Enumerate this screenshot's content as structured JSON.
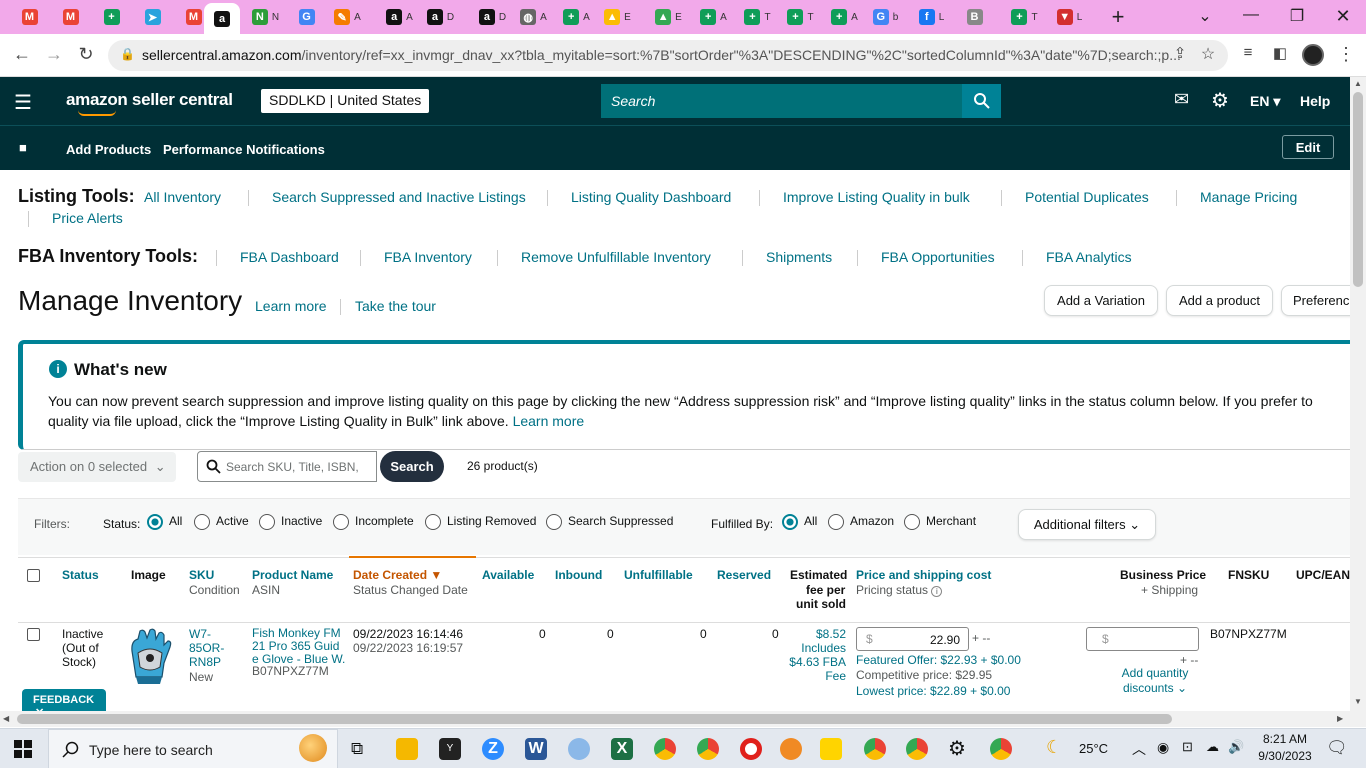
{
  "browser": {
    "tabs": [
      {
        "name": "gmail-icon",
        "color": "#ea4335",
        "glyph": "M"
      },
      {
        "name": "gmail-icon",
        "color": "#ea4335",
        "glyph": "M"
      },
      {
        "name": "sheets-icon",
        "color": "#0f9d58",
        "glyph": "+"
      },
      {
        "name": "telegram-icon",
        "color": "#2aa3dd",
        "glyph": "➤"
      },
      {
        "name": "gmail-icon",
        "color": "#ea4335",
        "glyph": "M"
      },
      {
        "name": "amazon-icon",
        "color": "#111",
        "glyph": "a"
      },
      {
        "name": "wolf-icon",
        "color": "#2e9d3a",
        "glyph": "N"
      },
      {
        "name": "google-icon",
        "color": "#4285f4",
        "glyph": "G"
      },
      {
        "name": "pencil-icon",
        "color": "#f57c00",
        "glyph": "✎"
      },
      {
        "name": "amazon-icon",
        "color": "#111",
        "glyph": "a"
      },
      {
        "name": "amazon-icon",
        "color": "#111",
        "glyph": "a"
      },
      {
        "name": "amazon-icon",
        "color": "#111",
        "glyph": "a"
      },
      {
        "name": "globe-icon",
        "color": "#666",
        "glyph": "◍"
      },
      {
        "name": "sheets-icon",
        "color": "#0f9d58",
        "glyph": "+"
      },
      {
        "name": "drive-icon",
        "color": "#fbbc04",
        "glyph": "▲"
      },
      {
        "name": "drive-icon",
        "color": "#34a853",
        "glyph": "▲"
      },
      {
        "name": "sheets-icon",
        "color": "#0f9d58",
        "glyph": "+"
      },
      {
        "name": "sheets-icon",
        "color": "#0f9d58",
        "glyph": "+"
      },
      {
        "name": "sheets-icon",
        "color": "#0f9d58",
        "glyph": "+"
      },
      {
        "name": "sheets-icon",
        "color": "#0f9d58",
        "glyph": "+"
      },
      {
        "name": "google-icon",
        "color": "#4285f4",
        "glyph": "G"
      },
      {
        "name": "facebook-icon",
        "color": "#1877f2",
        "glyph": "f"
      },
      {
        "name": "audio-tab-icon",
        "color": "#888",
        "glyph": "B"
      },
      {
        "name": "sheets-icon",
        "color": "#0f9d58",
        "glyph": "+"
      },
      {
        "name": "vpn-icon",
        "color": "#d32f2f",
        "glyph": "▼"
      }
    ],
    "tab_letters": [
      "",
      "",
      "",
      "",
      "",
      "",
      "N",
      "",
      "A",
      "A",
      "D",
      "D",
      "A",
      "A",
      "E",
      "E",
      "A",
      "T",
      "T",
      "A",
      "b",
      "L",
      "",
      "T",
      "L"
    ],
    "url_domain": "sellercentral.amazon.com",
    "url_path": "/inventory/ref=xx_invmgr_dnav_xx?tbla_myitable=sort:%7B\"sortOrder\"%3A\"DESCENDING\"%2C\"sortedColumnId\"%3A\"date\"%7D;search:;p..."
  },
  "header": {
    "logo": "amazon seller central",
    "store": "SDDLKD | United States",
    "search_placeholder": "Search",
    "language": "EN",
    "help": "Help"
  },
  "navbar": {
    "items": [
      "Add Products",
      "Performance Notifications"
    ],
    "edit": "Edit"
  },
  "listing_tools": {
    "label": "Listing Tools:",
    "links": [
      "All Inventory",
      "Search Suppressed and Inactive Listings",
      "Listing Quality Dashboard",
      "Improve Listing Quality in bulk",
      "Potential Duplicates",
      "Manage Pricing",
      "Price Alerts"
    ]
  },
  "fba_tools": {
    "label": "FBA Inventory Tools:",
    "links": [
      "FBA Dashboard",
      "FBA Inventory",
      "Remove Unfulfillable Inventory",
      "Shipments",
      "FBA Opportunities",
      "FBA Analytics"
    ]
  },
  "page": {
    "title": "Manage Inventory",
    "learn_more": "Learn more",
    "take_tour": "Take the tour",
    "buttons": [
      "Add a Variation",
      "Add a product",
      "Preferenc"
    ]
  },
  "whats_new": {
    "title": "What's new",
    "line1": "You can now prevent search suppression and improve listing quality on this page by clicking the new “Address suppression risk” and “Improve listing quality” links in the status column below. If you prefer to",
    "line2": "quality via file upload, click the “Improve Listing Quality in Bulk” link above.",
    "learn_more": "Learn more"
  },
  "toolbar": {
    "action": "Action on 0 selected",
    "search_placeholder": "Search SKU, Title, ISBN,",
    "search_btn": "Search",
    "count": "26 product(s)"
  },
  "filters": {
    "label": "Filters:",
    "status_label": "Status:",
    "status_options": [
      "All",
      "Active",
      "Inactive",
      "Incomplete",
      "Listing Removed",
      "Search Suppressed"
    ],
    "fulfilled_label": "Fulfilled By:",
    "fulfilled_options": [
      "All",
      "Amazon",
      "Merchant"
    ],
    "additional": "Additional filters"
  },
  "table": {
    "headers": {
      "status": "Status",
      "image": "Image",
      "sku": "SKU",
      "sku_sub": "Condition",
      "name": "Product Name",
      "name_sub": "ASIN",
      "date": "Date Created",
      "date_sub": "Status Changed Date",
      "available": "Available",
      "inbound": "Inbound",
      "unfulfillable": "Unfulfillable",
      "reserved": "Reserved",
      "fee1": "Estimated",
      "fee2": "fee per",
      "fee3": "unit sold",
      "price": "Price and shipping cost",
      "price_sub": "Pricing status",
      "business": "Business Price",
      "business_sub": "+ Shipping",
      "fnsku": "FNSKU",
      "upc": "UPC/EAN"
    },
    "row": {
      "status1": "Inactive",
      "status2": "(Out of",
      "status3": "Stock)",
      "sku1": "W7-",
      "sku2": "85OR-",
      "sku3": "RN8P",
      "condition": "New",
      "name1": "Fish Monkey FM",
      "name2": "21 Pro 365 Guid",
      "name3": "e Glove - Blue W.",
      "asin": "B07NPXZ77M",
      "created": "09/22/2023 16:14:46",
      "changed": "09/22/2023 16:19:57",
      "available": "0",
      "inbound": "0",
      "unfulfillable": "0",
      "reserved": "0",
      "fee1": "$8.52",
      "fee2": "Includes",
      "fee3": "$4.63 FBA",
      "fee4": "Fee",
      "currency": "$",
      "price": "22.90",
      "price_suffix": "+ --",
      "featured": "Featured Offer: $22.93 + $0.00",
      "competitive": "Competitive price: $29.95",
      "lowest": "Lowest price: $22.89 + $0.00",
      "business_currency": "$",
      "business_suffix": "+ --",
      "add_qty1": "Add quantity",
      "add_qty2": "discounts",
      "fnsku": "B07NPXZ77M"
    }
  },
  "feedback": "FEEDBACK",
  "taskbar": {
    "search_placeholder": "Type here to search",
    "weather": "25°C",
    "time": "8:21 AM",
    "date": "9/30/2023"
  }
}
